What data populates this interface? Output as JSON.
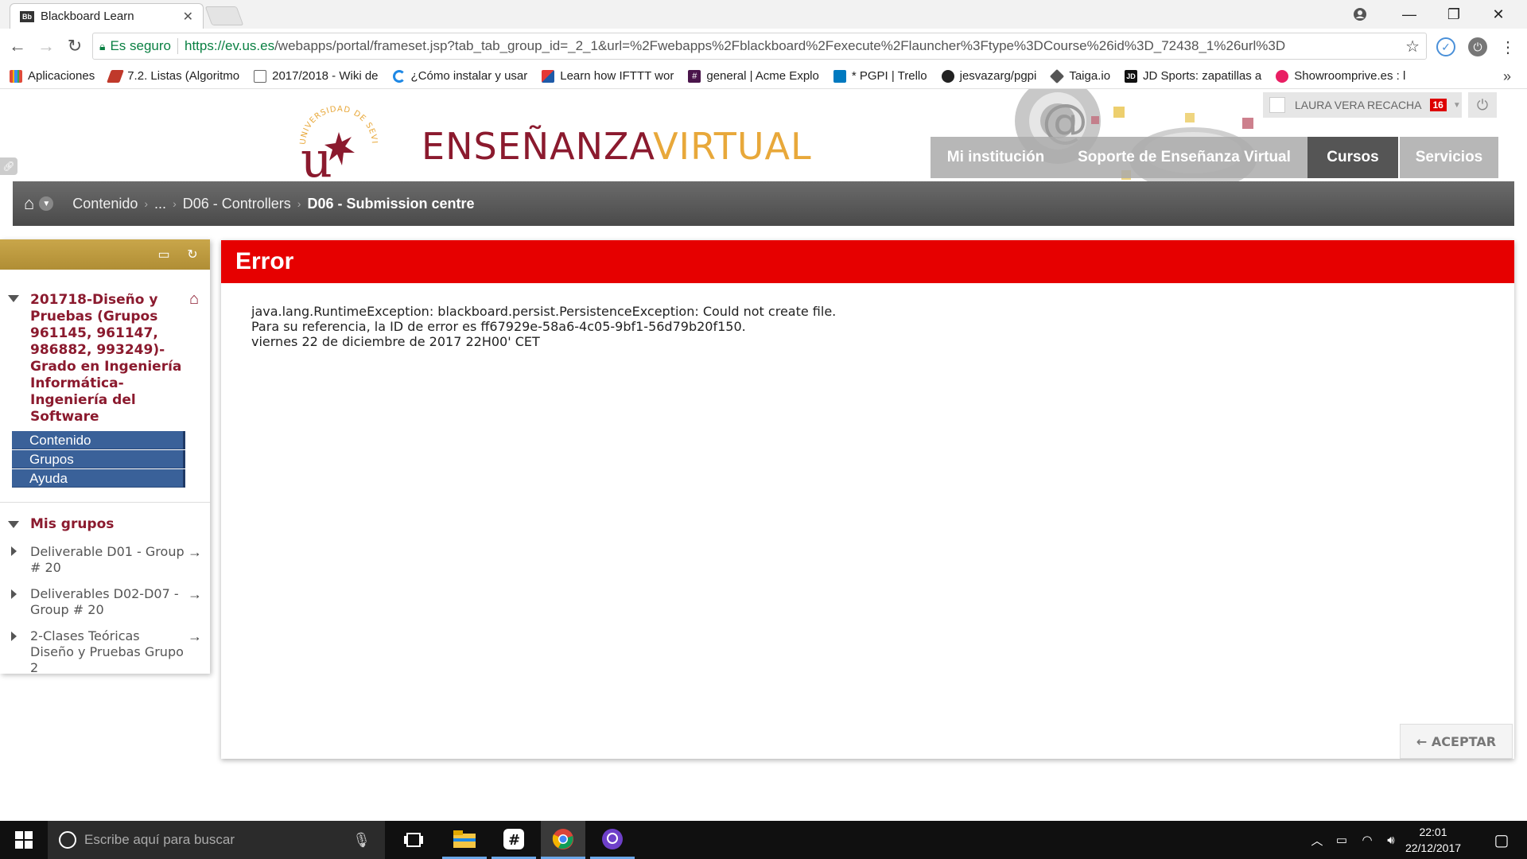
{
  "browser": {
    "tab_title": "Blackboard Learn",
    "tab_favicon": "Bb",
    "secure_label": "Es seguro",
    "url_host": "https://ev.us.es",
    "url_rest": "/webapps/portal/frameset.jsp?tab_tab_group_id=_2_1&url=%2Fwebapps%2Fblackboard%2Fexecute%2Flauncher%3Ftype%3DCourse%26id%3D_72438_1%26url%3D",
    "bookmarks": [
      {
        "label": "Aplicaciones",
        "icon": "apps-grid-icon",
        "color": "#e04a3a"
      },
      {
        "label": "7.2. Listas (Algoritmo",
        "icon": "bookmark-red-icon",
        "color": "#c0392b"
      },
      {
        "label": "2017/2018 - Wiki de",
        "icon": "page-icon",
        "color": "#ffffff"
      },
      {
        "label": "¿Cómo instalar y usar",
        "icon": "refresh-blue-icon",
        "color": "#1e88e5"
      },
      {
        "label": "Learn how IFTTT wor",
        "icon": "ifttt-icon",
        "color": "#1e5aa8"
      },
      {
        "label": "general | Acme Explo",
        "icon": "slack-icon",
        "color": "#4a154b"
      },
      {
        "label": "* PGPI | Trello",
        "icon": "trello-icon",
        "color": "#0079bf"
      },
      {
        "label": "jesvazarg/pgpi",
        "icon": "github-icon",
        "color": "#222222"
      },
      {
        "label": "Taiga.io",
        "icon": "taiga-icon",
        "color": "#555555"
      },
      {
        "label": "JD Sports: zapatillas a",
        "icon": "jd-icon",
        "color": "#111111"
      },
      {
        "label": "Showroomprive.es : l",
        "icon": "showroom-icon",
        "color": "#e91e63"
      }
    ]
  },
  "header": {
    "logo_line1": "ENSEÑANZA",
    "logo_line2": "VIRTUAL",
    "seal_text": "UNIVERSIDAD DE SEVILLA",
    "user_name": "LAURA VERA RECACHA",
    "notifications": "16",
    "nav": [
      "Mi institución",
      "Soporte de Enseñanza Virtual",
      "Cursos",
      "Servicios"
    ]
  },
  "breadcrumb": {
    "items": [
      "Contenido",
      "...",
      "D06 - Controllers"
    ],
    "current": "D06 - Submission centre"
  },
  "course_menu": {
    "course_title": "201718-Diseño y Pruebas (Grupos 961145, 961147, 986882, 993249)- Grado en Ingeniería Informática- Ingeniería del Software",
    "links": [
      "Contenido",
      "Grupos",
      "Ayuda"
    ],
    "groups_title": "Mis grupos",
    "groups": [
      "Deliverable D01 - Group # 20",
      "Deliverables D02-D07 - Group # 20",
      "2-Clases Teóricas Diseño y Pruebas Grupo 2"
    ]
  },
  "error": {
    "title": "Error",
    "line1": "java.lang.RuntimeException: blackboard.persist.PersistenceException: Could not create file.",
    "line2": "Para su referencia, la ID de error es ff67929e-58a6-4c05-9bf1-56d79b20f150.",
    "line3": "viernes 22 de diciembre de 2017 22H00' CET",
    "accept_label": "← ACEPTAR"
  },
  "taskbar": {
    "search_placeholder": "Escribe aquí para buscar",
    "time": "22:01",
    "date": "22/12/2017"
  },
  "colors": {
    "error_red": "#e60000",
    "brand_maroon": "#8b1a2e",
    "brand_gold": "#e8a83a",
    "menu_blue": "#3a6199"
  }
}
